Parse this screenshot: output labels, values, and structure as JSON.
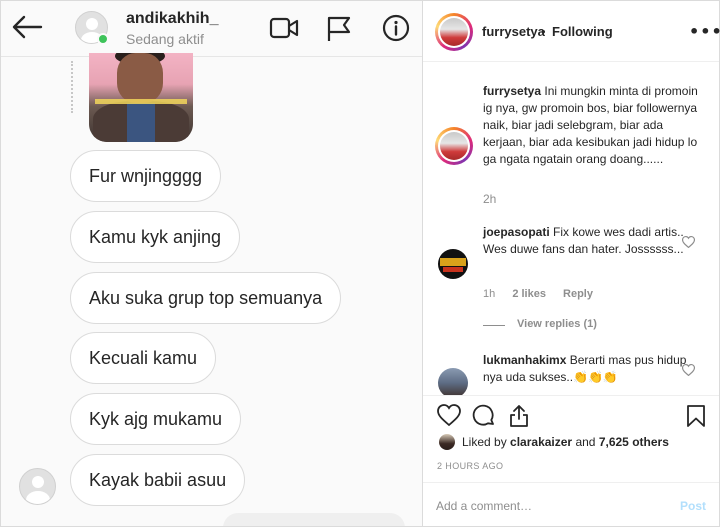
{
  "chat": {
    "username": "andikakhih_",
    "status": "Sedang aktif",
    "messages": [
      "Fur wnjingggg",
      "Kamu kyk anjing",
      "Aku suka grup top semuanya",
      "Kecuali kamu",
      "Kyk ajg mukamu",
      "Kayak babii asuu"
    ],
    "icons": [
      "back-arrow-icon",
      "video-call-icon",
      "flag-icon",
      "info-icon"
    ],
    "active_color": "#3ec35a"
  },
  "post": {
    "username": "furrysetya",
    "separator": "•",
    "follow_status": "Following",
    "more": "•••",
    "caption": {
      "user": "furrysetya",
      "text": "Ini mungkin minta di promoin ig nya, gw promoin bos, biar followernya naik, biar jadi selebgram, biar ada kerjaan, biar ada kesibukan jadi hidup lo ga ngata ngatain orang doang......",
      "time": "2h"
    },
    "comments": [
      {
        "user": "joepasopati",
        "text": "Fix kowe wes dadi artis.. Wes duwe fans dan hater. Jossssss...",
        "time": "1h",
        "likes": "2 likes",
        "reply": "Reply",
        "view_replies": "View replies (1)"
      },
      {
        "user": "lukmanhakimx",
        "text": "Berarti mas pus hidup nya uda sukses..👏👏👏"
      }
    ],
    "liked_by_prefix": "Liked by",
    "liked_by_user": "clarakaizer",
    "liked_by_and": "and",
    "liked_by_others": "7,625 others",
    "age": "2 HOURS AGO",
    "comment_placeholder": "Add a comment…",
    "post_label": "Post",
    "post_button_color": "#b2dffc"
  }
}
